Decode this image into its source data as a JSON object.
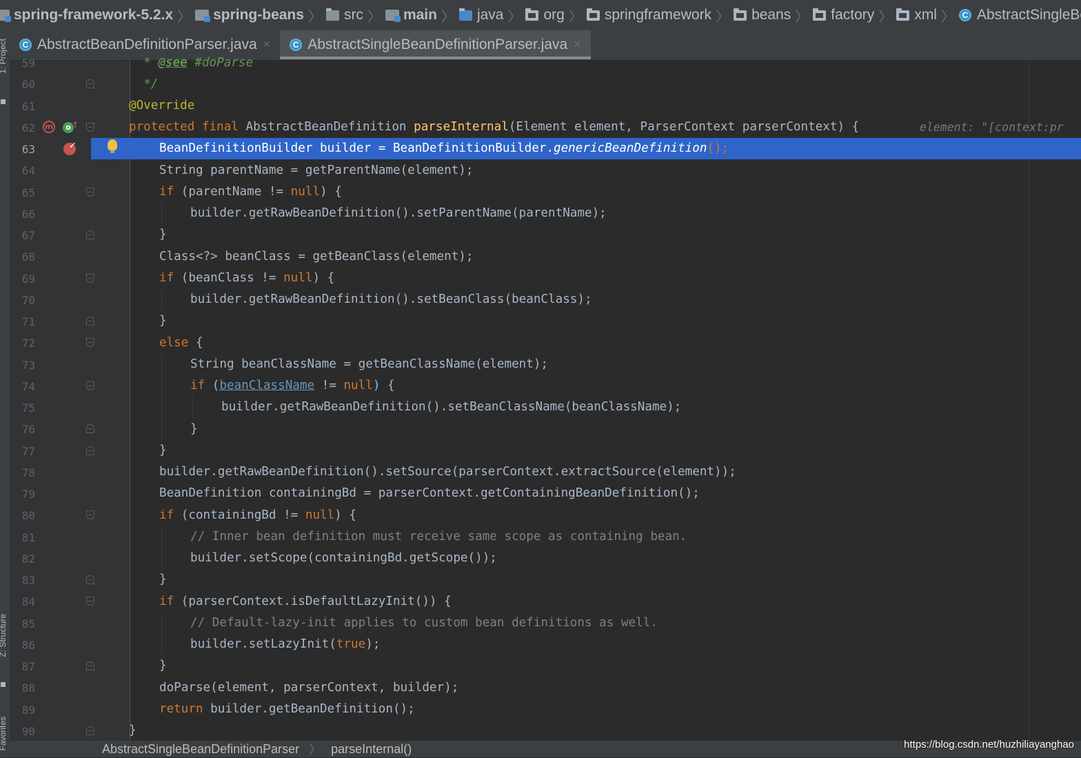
{
  "navbar": {
    "items": [
      {
        "label": "spring-framework-5.2.x",
        "icon": "module-icon",
        "bold": true
      },
      {
        "label": "spring-beans",
        "icon": "module-icon",
        "bold": true
      },
      {
        "label": "src",
        "icon": "folder-icon"
      },
      {
        "label": "main",
        "icon": "source-root-icon",
        "bold": true
      },
      {
        "label": "java",
        "icon": "source-folder-icon"
      },
      {
        "label": "org",
        "icon": "package-icon"
      },
      {
        "label": "springframework",
        "icon": "package-icon"
      },
      {
        "label": "beans",
        "icon": "package-icon"
      },
      {
        "label": "factory",
        "icon": "package-icon"
      },
      {
        "label": "xml",
        "icon": "package-icon"
      },
      {
        "label": "AbstractSingleBeanDefinitio",
        "icon": "abstract-class-icon"
      }
    ]
  },
  "tabs": [
    {
      "label": "AbstractBeanDefinitionParser.java",
      "close": "×",
      "active": false
    },
    {
      "label": "AbstractSingleBeanDefinitionParser.java",
      "close": "×",
      "active": true
    }
  ],
  "toolstrip": {
    "top_label": "1: Project",
    "bottom_label": "Z: Structure",
    "last_label": "Favorites"
  },
  "editor": {
    "current_line": "63",
    "line_numbers": [
      "59",
      "60",
      "61",
      "62",
      "63",
      "64",
      "65",
      "66",
      "67",
      "68",
      "69",
      "70",
      "71",
      "72",
      "73",
      "74",
      "75",
      "76",
      "77",
      "78",
      "79",
      "80",
      "81",
      "82",
      "83",
      "84",
      "85",
      "86",
      "87",
      "88",
      "89",
      "90"
    ],
    "inlay_hint": "element: \"[context:pr",
    "code": {
      "l59_tag": "@see",
      "l59_ref": " #doParse",
      "l60": "*/",
      "l61": "@Override",
      "l62_kw": "protected final ",
      "l62_type": "AbstractBeanDefinition ",
      "l62_fn": "parseInternal",
      "l62_rest": "(Element element, ParserContext parserContext) {",
      "l63_a": "BeanDefinitionBuilder builder = BeanDefinitionBuilder.",
      "l63_b": "genericBeanDefinition",
      "l63_c": "();",
      "l64": "String parentName = getParentName(element);",
      "l65_kw": "if ",
      "l65_a": "(parentName != ",
      "l65_null": "null",
      "l65_b": ") {",
      "l66": "builder.getRawBeanDefinition().setParentName(parentName);",
      "l67": "}",
      "l68": "Class<?> beanClass = getBeanClass(element);",
      "l69_kw": "if ",
      "l69_a": "(beanClass != ",
      "l69_null": "null",
      "l69_b": ") {",
      "l70": "builder.getRawBeanDefinition().setBeanClass(beanClass);",
      "l71": "}",
      "l72_kw": "else",
      "l72_b": " {",
      "l73": "String beanClassName = getBeanClassName(element);",
      "l74_kw": "if ",
      "l74_a": "(",
      "l74_var": "beanClassName",
      "l74_b": " != ",
      "l74_null": "null",
      "l74_c": ") {",
      "l75": "builder.getRawBeanDefinition().setBeanClassName(beanClassName);",
      "l76": "}",
      "l77": "}",
      "l78": "builder.getRawBeanDefinition().setSource(parserContext.extractSource(element));",
      "l79": "BeanDefinition containingBd = parserContext.getContainingBeanDefinition();",
      "l80_kw": "if ",
      "l80_a": "(containingBd != ",
      "l80_null": "null",
      "l80_b": ") {",
      "l81": "// Inner bean definition must receive same scope as containing bean.",
      "l82": "builder.setScope(containingBd.getScope());",
      "l83": "}",
      "l84_kw": "if ",
      "l84_a": "(parserContext.isDefaultLazyInit()) {",
      "l85": "// Default-lazy-init applies to custom bean definitions as well.",
      "l86_a": "builder.setLazyInit(",
      "l86_kw": "true",
      "l86_b": ");",
      "l87": "}",
      "l88": "doParse(element, parserContext, builder);",
      "l89_kw": "return ",
      "l89_a": "builder.getBeanDefinition();",
      "l90": "}"
    }
  },
  "breadcrumb": {
    "class": "AbstractSingleBeanDefinitionParser",
    "method": "parseInternal()"
  },
  "watermark": "https://blog.csdn.net/huzhiliayanghao",
  "colors": {
    "background": "#2b2b2b",
    "gutter": "#313335",
    "keyword": "#cc7832",
    "annotation": "#bbb529",
    "method_decl": "#ffc66d",
    "comment": "#808080",
    "selection": "#2f65ca",
    "breakpoint": "#c75450"
  }
}
